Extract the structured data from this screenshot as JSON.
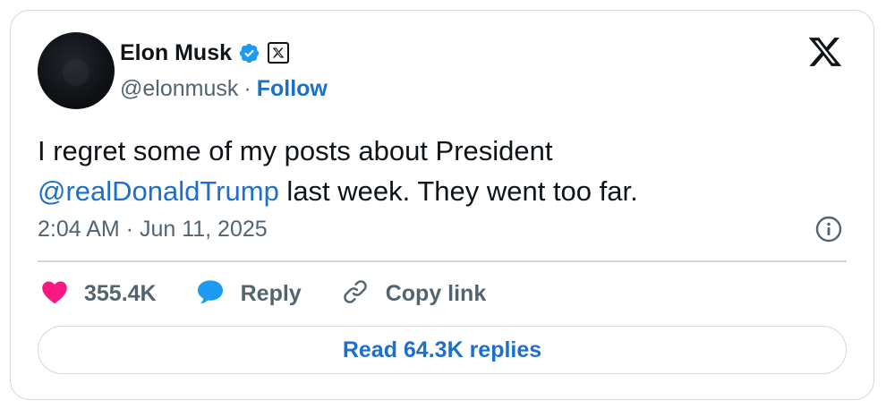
{
  "author": {
    "display_name": "Elon Musk",
    "handle": "@elonmusk",
    "separator": "·",
    "follow_label": "Follow",
    "avatar_icon": "avatar-dark",
    "verified_icon": "verified-badge-icon",
    "affiliation_icon": "x-affiliate-badge-icon"
  },
  "tweet": {
    "text_part1": "I regret some of my posts about President",
    "mention": "@realDonaldTrump",
    "text_part2": " last week. They went too far.",
    "timestamp": "2:04 AM · Jun 11, 2025"
  },
  "actions": {
    "likes_count": "355.4K",
    "reply_label": "Reply",
    "copy_link_label": "Copy link"
  },
  "footer": {
    "read_replies_label": "Read 64.3K replies"
  },
  "colors": {
    "link_blue": "#1d70c9",
    "like_pink": "#f91880",
    "reply_blue": "#1d9bf0",
    "text_dark": "#0f1419",
    "text_gray": "#536471",
    "border": "#cfd9de"
  }
}
